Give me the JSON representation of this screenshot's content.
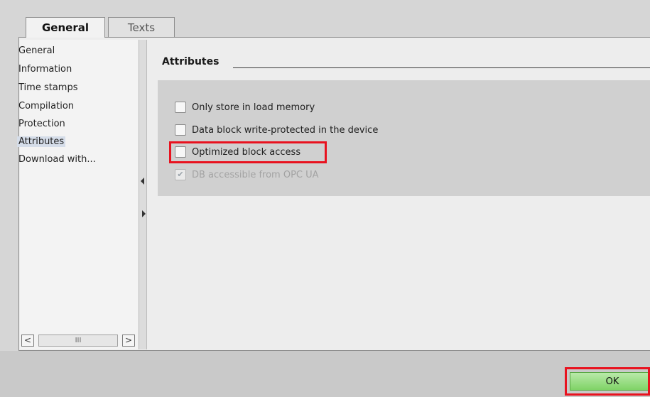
{
  "tabs": [
    {
      "label": "General",
      "active": true
    },
    {
      "label": "Texts",
      "active": false
    }
  ],
  "sidebar": {
    "items": [
      {
        "label": "General"
      },
      {
        "label": "Information"
      },
      {
        "label": "Time stamps"
      },
      {
        "label": "Compilation"
      },
      {
        "label": "Protection"
      },
      {
        "label": "Attributes",
        "selected": true
      },
      {
        "label": "Download with..."
      }
    ],
    "scroll_left": "<",
    "scroll_right": ">",
    "scroll_thumb": "III"
  },
  "attributes": {
    "title": "Attributes",
    "options": [
      {
        "label": "Only store in load memory",
        "checked": false,
        "disabled": false
      },
      {
        "label": "Data block write-protected in the device",
        "checked": false,
        "disabled": false
      },
      {
        "label": "Optimized block access",
        "checked": false,
        "disabled": false,
        "highlighted": true
      },
      {
        "label": "DB accessible from OPC UA",
        "checked": true,
        "disabled": true
      }
    ]
  },
  "footer": {
    "ok_label": "OK"
  },
  "colors": {
    "highlight": "#e8121f",
    "ok_button": "#8fd978",
    "selected_item": "#d5dde9"
  }
}
